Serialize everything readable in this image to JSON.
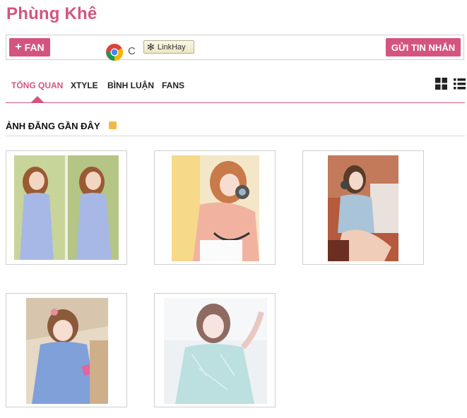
{
  "colors": {
    "accent": "#d3557f"
  },
  "profile": {
    "name": "Phùng Khê"
  },
  "toolbar": {
    "fan_label": "FAN",
    "fan_icon": "plus-icon",
    "browser_icon": "chrome-icon",
    "browser_trailing": "C",
    "linkhay_label": "LinkHay",
    "message_label": "GỬI TIN NHẮN"
  },
  "tabs": [
    {
      "label": "TỔNG QUAN",
      "active": true
    },
    {
      "label": "XTYLE",
      "active": false
    },
    {
      "label": "BÌNH LUẬN",
      "active": false
    },
    {
      "label": "FANS",
      "active": false
    }
  ],
  "view_icons": [
    "grid-view-icon",
    "list-view-icon"
  ],
  "section": {
    "title": "ẢNH ĐĂNG GẦN ĐÂY",
    "icon": "rss-icon"
  },
  "photos": [
    {
      "name": "photo-1"
    },
    {
      "name": "photo-2"
    },
    {
      "name": "photo-3"
    },
    {
      "name": "photo-4"
    },
    {
      "name": "photo-5"
    }
  ]
}
